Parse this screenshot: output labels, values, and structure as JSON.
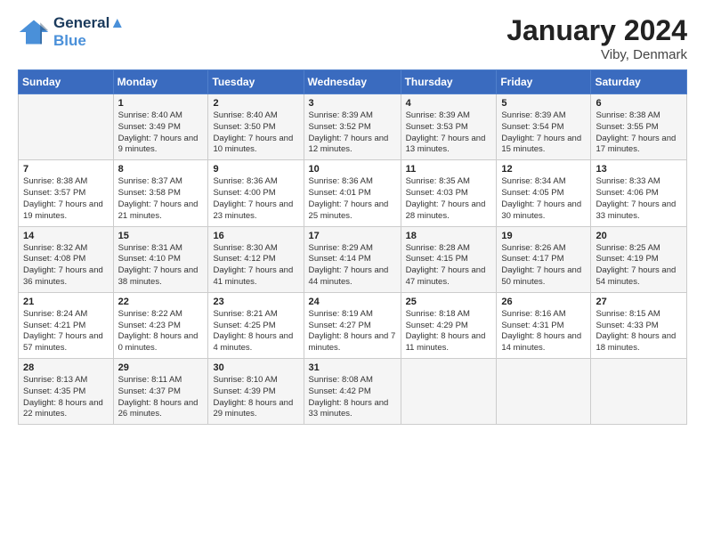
{
  "header": {
    "logo_line1": "General",
    "logo_line2": "Blue",
    "month_year": "January 2024",
    "location": "Viby, Denmark"
  },
  "days_of_week": [
    "Sunday",
    "Monday",
    "Tuesday",
    "Wednesday",
    "Thursday",
    "Friday",
    "Saturday"
  ],
  "weeks": [
    [
      {
        "day": "",
        "sunrise": "",
        "sunset": "",
        "daylight": ""
      },
      {
        "day": "1",
        "sunrise": "8:40 AM",
        "sunset": "3:49 PM",
        "daylight": "7 hours and 9 minutes."
      },
      {
        "day": "2",
        "sunrise": "8:40 AM",
        "sunset": "3:50 PM",
        "daylight": "7 hours and 10 minutes."
      },
      {
        "day": "3",
        "sunrise": "8:39 AM",
        "sunset": "3:52 PM",
        "daylight": "7 hours and 12 minutes."
      },
      {
        "day": "4",
        "sunrise": "8:39 AM",
        "sunset": "3:53 PM",
        "daylight": "7 hours and 13 minutes."
      },
      {
        "day": "5",
        "sunrise": "8:39 AM",
        "sunset": "3:54 PM",
        "daylight": "7 hours and 15 minutes."
      },
      {
        "day": "6",
        "sunrise": "8:38 AM",
        "sunset": "3:55 PM",
        "daylight": "7 hours and 17 minutes."
      }
    ],
    [
      {
        "day": "7",
        "sunrise": "8:38 AM",
        "sunset": "3:57 PM",
        "daylight": "7 hours and 19 minutes."
      },
      {
        "day": "8",
        "sunrise": "8:37 AM",
        "sunset": "3:58 PM",
        "daylight": "7 hours and 21 minutes."
      },
      {
        "day": "9",
        "sunrise": "8:36 AM",
        "sunset": "4:00 PM",
        "daylight": "7 hours and 23 minutes."
      },
      {
        "day": "10",
        "sunrise": "8:36 AM",
        "sunset": "4:01 PM",
        "daylight": "7 hours and 25 minutes."
      },
      {
        "day": "11",
        "sunrise": "8:35 AM",
        "sunset": "4:03 PM",
        "daylight": "7 hours and 28 minutes."
      },
      {
        "day": "12",
        "sunrise": "8:34 AM",
        "sunset": "4:05 PM",
        "daylight": "7 hours and 30 minutes."
      },
      {
        "day": "13",
        "sunrise": "8:33 AM",
        "sunset": "4:06 PM",
        "daylight": "7 hours and 33 minutes."
      }
    ],
    [
      {
        "day": "14",
        "sunrise": "8:32 AM",
        "sunset": "4:08 PM",
        "daylight": "7 hours and 36 minutes."
      },
      {
        "day": "15",
        "sunrise": "8:31 AM",
        "sunset": "4:10 PM",
        "daylight": "7 hours and 38 minutes."
      },
      {
        "day": "16",
        "sunrise": "8:30 AM",
        "sunset": "4:12 PM",
        "daylight": "7 hours and 41 minutes."
      },
      {
        "day": "17",
        "sunrise": "8:29 AM",
        "sunset": "4:14 PM",
        "daylight": "7 hours and 44 minutes."
      },
      {
        "day": "18",
        "sunrise": "8:28 AM",
        "sunset": "4:15 PM",
        "daylight": "7 hours and 47 minutes."
      },
      {
        "day": "19",
        "sunrise": "8:26 AM",
        "sunset": "4:17 PM",
        "daylight": "7 hours and 50 minutes."
      },
      {
        "day": "20",
        "sunrise": "8:25 AM",
        "sunset": "4:19 PM",
        "daylight": "7 hours and 54 minutes."
      }
    ],
    [
      {
        "day": "21",
        "sunrise": "8:24 AM",
        "sunset": "4:21 PM",
        "daylight": "7 hours and 57 minutes."
      },
      {
        "day": "22",
        "sunrise": "8:22 AM",
        "sunset": "4:23 PM",
        "daylight": "8 hours and 0 minutes."
      },
      {
        "day": "23",
        "sunrise": "8:21 AM",
        "sunset": "4:25 PM",
        "daylight": "8 hours and 4 minutes."
      },
      {
        "day": "24",
        "sunrise": "8:19 AM",
        "sunset": "4:27 PM",
        "daylight": "8 hours and 7 minutes."
      },
      {
        "day": "25",
        "sunrise": "8:18 AM",
        "sunset": "4:29 PM",
        "daylight": "8 hours and 11 minutes."
      },
      {
        "day": "26",
        "sunrise": "8:16 AM",
        "sunset": "4:31 PM",
        "daylight": "8 hours and 14 minutes."
      },
      {
        "day": "27",
        "sunrise": "8:15 AM",
        "sunset": "4:33 PM",
        "daylight": "8 hours and 18 minutes."
      }
    ],
    [
      {
        "day": "28",
        "sunrise": "8:13 AM",
        "sunset": "4:35 PM",
        "daylight": "8 hours and 22 minutes."
      },
      {
        "day": "29",
        "sunrise": "8:11 AM",
        "sunset": "4:37 PM",
        "daylight": "8 hours and 26 minutes."
      },
      {
        "day": "30",
        "sunrise": "8:10 AM",
        "sunset": "4:39 PM",
        "daylight": "8 hours and 29 minutes."
      },
      {
        "day": "31",
        "sunrise": "8:08 AM",
        "sunset": "4:42 PM",
        "daylight": "8 hours and 33 minutes."
      },
      {
        "day": "",
        "sunrise": "",
        "sunset": "",
        "daylight": ""
      },
      {
        "day": "",
        "sunrise": "",
        "sunset": "",
        "daylight": ""
      },
      {
        "day": "",
        "sunrise": "",
        "sunset": "",
        "daylight": ""
      }
    ]
  ]
}
